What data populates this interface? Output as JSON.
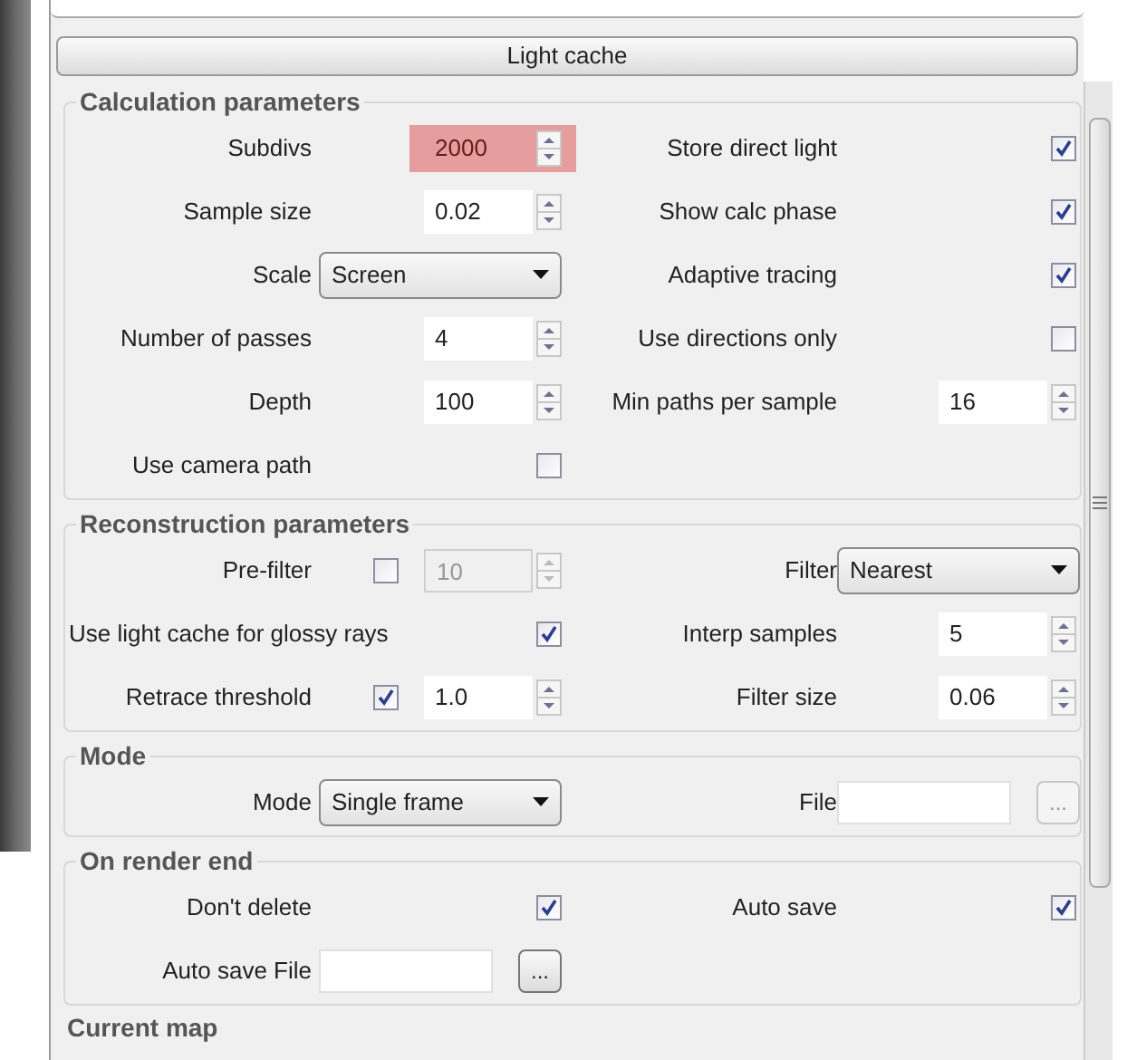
{
  "rollout": {
    "title": "Light cache"
  },
  "sections": [
    {
      "title": "Calculation parameters",
      "rows": [
        {
          "left": {
            "label": "Subdivs",
            "controls": [
              {
                "kind": "spinner",
                "value": "2000",
                "highlighted": true,
                "disabled": false
              }
            ]
          },
          "right": {
            "label": "Store direct light",
            "controls": [
              {
                "kind": "checkbox",
                "checked": true
              }
            ]
          }
        },
        {
          "left": {
            "label": "Sample size",
            "controls": [
              {
                "kind": "spinner",
                "value": "0.02",
                "highlighted": false,
                "disabled": false
              }
            ]
          },
          "right": {
            "label": "Show calc phase",
            "controls": [
              {
                "kind": "checkbox",
                "checked": true
              }
            ]
          }
        },
        {
          "left": {
            "label": "Scale",
            "controls": [
              {
                "kind": "dropdown",
                "value": "Screen"
              }
            ]
          },
          "right": {
            "label": "Adaptive tracing",
            "controls": [
              {
                "kind": "checkbox",
                "checked": true
              }
            ]
          }
        },
        {
          "left": {
            "label": "Number of passes",
            "controls": [
              {
                "kind": "spinner",
                "value": "4",
                "highlighted": false,
                "disabled": false
              }
            ]
          },
          "right": {
            "label": "Use directions only",
            "controls": [
              {
                "kind": "checkbox",
                "checked": false
              }
            ]
          }
        },
        {
          "left": {
            "label": "Depth",
            "controls": [
              {
                "kind": "spinner",
                "value": "100",
                "highlighted": false,
                "disabled": false
              }
            ]
          },
          "right": {
            "label": "Min paths per sample",
            "controls": [
              {
                "kind": "spinner",
                "value": "16",
                "highlighted": false,
                "disabled": false
              }
            ]
          }
        },
        {
          "left": {
            "label": "Use camera path",
            "controls": [
              {
                "kind": "checkbox",
                "checked": false
              }
            ]
          }
        }
      ]
    },
    {
      "title": "Reconstruction parameters",
      "rows": [
        {
          "left": {
            "label": "Pre-filter",
            "controls": [
              {
                "kind": "checkbox",
                "checked": false
              },
              {
                "kind": "spinner",
                "value": "10",
                "highlighted": false,
                "disabled": true
              }
            ]
          },
          "right": {
            "label": "Filter",
            "controls": [
              {
                "kind": "dropdown",
                "value": "Nearest"
              }
            ]
          }
        },
        {
          "left": {
            "label": "Use light cache for glossy rays",
            "controls": [
              {
                "kind": "checkbox",
                "checked": true
              }
            ]
          },
          "right": {
            "label": "Interp samples",
            "controls": [
              {
                "kind": "spinner",
                "value": "5",
                "highlighted": false,
                "disabled": false
              }
            ]
          }
        },
        {
          "left": {
            "label": "Retrace threshold",
            "controls": [
              {
                "kind": "checkbox",
                "checked": true
              },
              {
                "kind": "spinner",
                "value": "1.0",
                "highlighted": false,
                "disabled": false
              }
            ]
          },
          "right": {
            "label": "Filter size",
            "controls": [
              {
                "kind": "spinner",
                "value": "0.06",
                "highlighted": false,
                "disabled": false
              }
            ]
          }
        }
      ]
    },
    {
      "title": "Mode",
      "rows": [
        {
          "left": {
            "label": "Mode",
            "controls": [
              {
                "kind": "dropdown",
                "value": "Single frame"
              }
            ]
          },
          "right": {
            "label": "File",
            "controls": [
              {
                "kind": "field"
              },
              {
                "kind": "browse",
                "label": "...",
                "disabled": true
              }
            ]
          }
        }
      ]
    },
    {
      "title": "On render end",
      "rows": [
        {
          "left": {
            "label": "Don't delete",
            "controls": [
              {
                "kind": "checkbox",
                "checked": true
              }
            ]
          },
          "right": {
            "label": "Auto save",
            "controls": [
              {
                "kind": "checkbox",
                "checked": true
              }
            ]
          }
        },
        {
          "left": {
            "label": "Auto save File",
            "controls": [
              {
                "kind": "field"
              },
              {
                "kind": "browse",
                "label": "...",
                "disabled": false
              }
            ]
          }
        }
      ]
    }
  ],
  "next_section": {
    "title": "Current map"
  }
}
